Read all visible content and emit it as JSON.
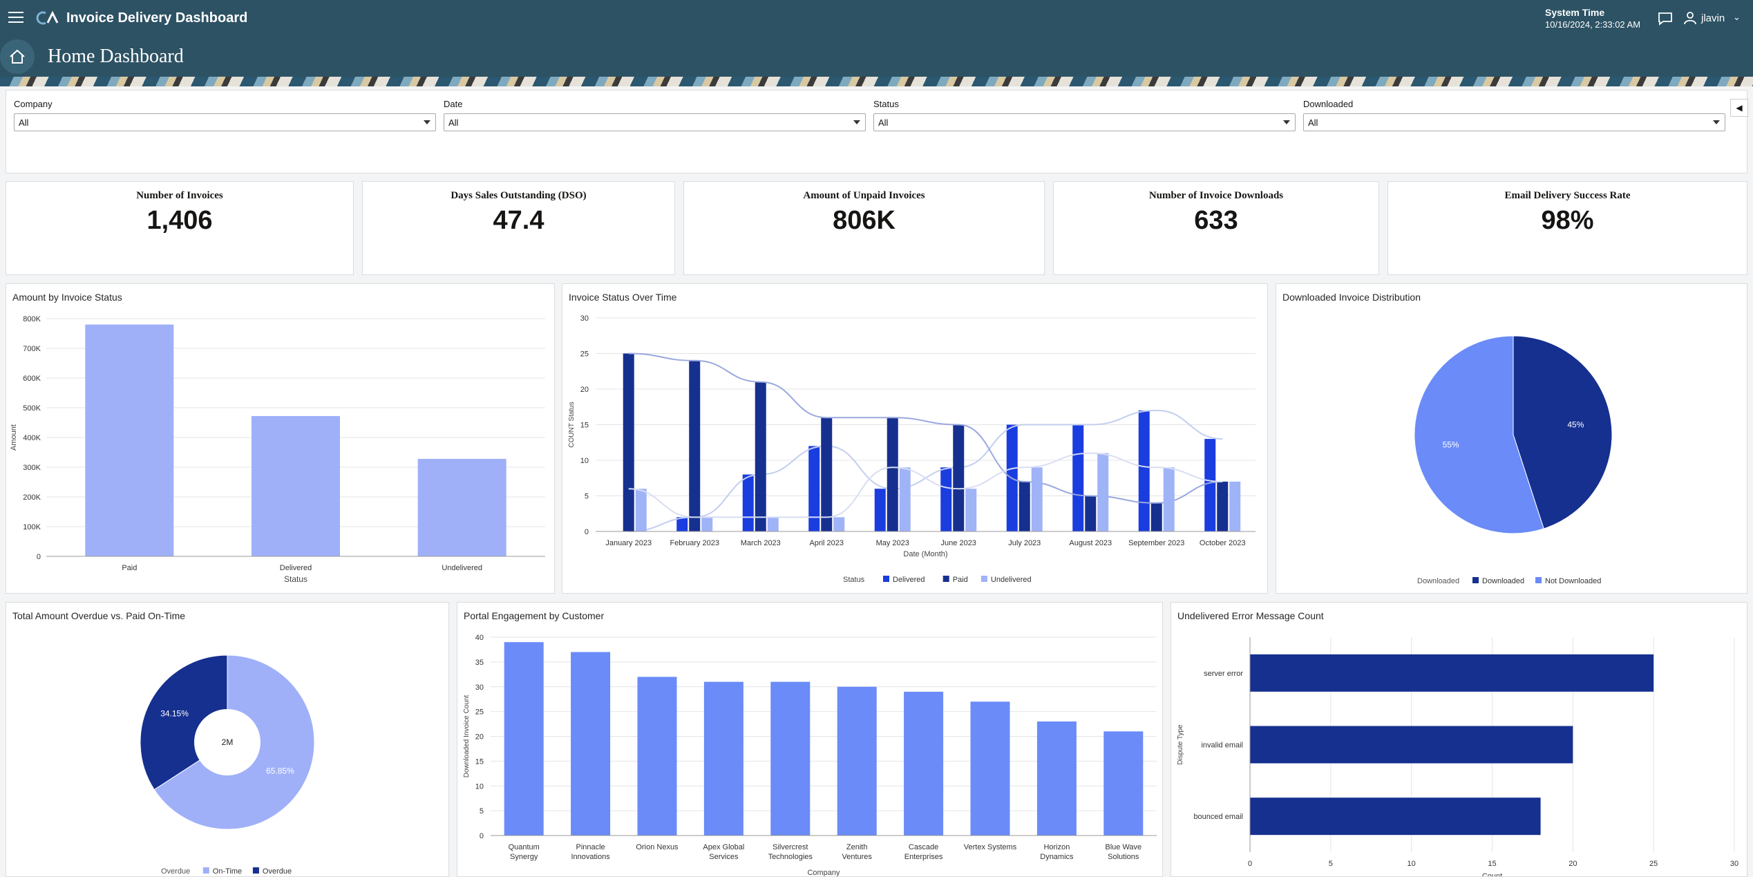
{
  "app": {
    "title": "Invoice Delivery Dashboard",
    "page_title": "Home Dashboard"
  },
  "system_time": {
    "label": "System Time",
    "value": "10/16/2024, 2:33:02 AM"
  },
  "user": {
    "name": "jlavin"
  },
  "icons": [
    "hamburger-menu-icon",
    "oracle-logo-icon",
    "chat-icon",
    "user-icon",
    "chevron-down-icon",
    "home-icon",
    "collapse-left-icon"
  ],
  "colors": {
    "header": "#2d5264",
    "delivered": "#1a3de0",
    "paid": "#16308f",
    "undelivered": "#9fb3f7",
    "bar_light": "#9fb0f9",
    "bar_mid": "#6a8bf8"
  },
  "filters": [
    {
      "label": "Company",
      "value": "All"
    },
    {
      "label": "Date",
      "value": "All"
    },
    {
      "label": "Status",
      "value": "All"
    },
    {
      "label": "Downloaded",
      "value": "All"
    }
  ],
  "kpis": [
    {
      "title": "Number of Invoices",
      "value": "1,406"
    },
    {
      "title": "Days Sales Outstanding (DSO)",
      "value": "47.4"
    },
    {
      "title": "Amount of Unpaid Invoices",
      "value": "806K"
    },
    {
      "title": "Number of Invoice Downloads",
      "value": "633"
    },
    {
      "title": "Email Delivery Success Rate",
      "value": "98%"
    }
  ],
  "chart_data": [
    {
      "title": "Amount by Invoice Status",
      "type": "bar",
      "categories": [
        "Paid",
        "Delivered",
        "Undelivered"
      ],
      "values": [
        780000,
        472000,
        328000
      ],
      "xlabel": "Status",
      "ylabel": "Amount",
      "ylim": [
        0,
        800000
      ],
      "yticks": [
        "0",
        "100K",
        "200K",
        "300K",
        "400K",
        "500K",
        "600K",
        "700K",
        "800K"
      ],
      "grid": true
    },
    {
      "title": "Invoice Status Over Time",
      "type": "bar",
      "categories": [
        "January 2023",
        "February 2023",
        "March 2023",
        "April 2023",
        "May 2023",
        "June 2023",
        "July 2023",
        "August 2023",
        "September 2023",
        "October 2023"
      ],
      "series": [
        {
          "name": "Delivered",
          "values": [
            0,
            2,
            8,
            12,
            6,
            9,
            15,
            15,
            17,
            13
          ]
        },
        {
          "name": "Paid",
          "values": [
            25,
            24,
            21,
            16,
            16,
            15,
            7,
            5,
            4,
            7
          ]
        },
        {
          "name": "Undelivered",
          "values": [
            6,
            2,
            2,
            2,
            9,
            6,
            9,
            11,
            9,
            7
          ]
        }
      ],
      "trend_lines": true,
      "xlabel": "Date (Month)",
      "ylabel": "COUNT Status",
      "ylim": [
        0,
        30
      ],
      "yticks": [
        0,
        5,
        10,
        15,
        20,
        25,
        30
      ],
      "legend_title": "Status",
      "legend_position": "bottom",
      "grid": true
    },
    {
      "title": "Downloaded Invoice Distribution",
      "type": "pie",
      "slices": [
        {
          "name": "Downloaded",
          "value": 45,
          "label": "45%"
        },
        {
          "name": "Not Downloaded",
          "value": 55,
          "label": "55%"
        }
      ],
      "legend_title": "Downloaded",
      "legend_position": "bottom"
    },
    {
      "title": "Total Amount Overdue vs. Paid On-Time",
      "type": "pie",
      "donut": true,
      "center_label": "2M",
      "slices": [
        {
          "name": "On-Time",
          "value": 65.85,
          "label": "65.85%"
        },
        {
          "name": "Overdue",
          "value": 34.15,
          "label": "34.15%"
        }
      ],
      "legend_title": "Overdue",
      "legend_position": "bottom"
    },
    {
      "title": "Portal Engagement by Customer",
      "type": "bar",
      "categories": [
        "Quantum Synergy",
        "Pinnacle Innovations",
        "Orion Nexus",
        "Apex Global Services",
        "Silvercrest Technologies",
        "Zenith Ventures",
        "Cascade Enterprises",
        "Vertex Systems",
        "Horizon Dynamics",
        "Blue Wave Solutions"
      ],
      "values": [
        39,
        37,
        32,
        31,
        31,
        30,
        29,
        27,
        23,
        21
      ],
      "xlabel": "Company",
      "ylabel": "Downloaded Invoice Count",
      "ylim": [
        0,
        40
      ],
      "yticks": [
        0,
        5,
        10,
        15,
        20,
        25,
        30,
        35,
        40
      ],
      "grid": true
    },
    {
      "title": "Undelivered Error Message Count",
      "type": "bar",
      "orientation": "horizontal",
      "categories": [
        "server error",
        "invalid email",
        "bounced email"
      ],
      "values": [
        25,
        20,
        18
      ],
      "xlabel": "Count",
      "ylabel": "Dispute Type",
      "xlim": [
        0,
        30
      ],
      "xticks": [
        0,
        5,
        10,
        15,
        20,
        25,
        30
      ],
      "grid": true
    }
  ]
}
